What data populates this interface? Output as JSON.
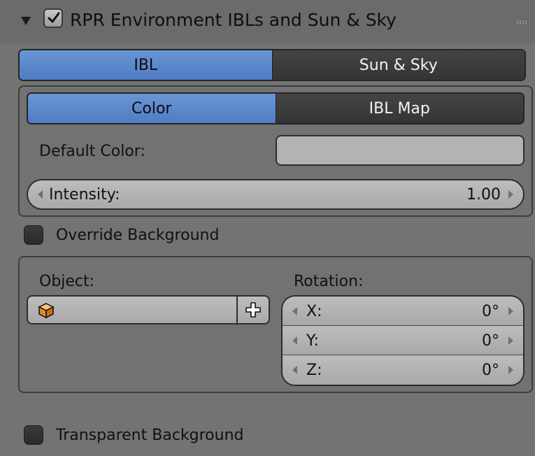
{
  "header": {
    "title": "RPR Environment IBLs and Sun & Sky",
    "enabled": true,
    "icons": {
      "collapse": "triangle-down-icon",
      "enable": "checkmark-icon",
      "drag": "grip-icon"
    }
  },
  "mode_tabs": {
    "options": [
      "IBL",
      "Sun & Sky"
    ],
    "selected": "IBL"
  },
  "ibl_tabs": {
    "options": [
      "Color",
      "IBL Map"
    ],
    "selected": "Color"
  },
  "default_color": {
    "label": "Default Color:",
    "value": "#b3b3b3"
  },
  "intensity": {
    "label": "Intensity:",
    "value": "1.00"
  },
  "override_background": {
    "label": "Override Background",
    "checked": false
  },
  "object": {
    "label": "Object:",
    "value": "",
    "icon": "object-cube-icon",
    "add_icon": "plus-icon"
  },
  "rotation": {
    "label": "Rotation:",
    "fields": [
      {
        "label": "X:",
        "value": "0°"
      },
      {
        "label": "Y:",
        "value": "0°"
      },
      {
        "label": "Z:",
        "value": "0°"
      }
    ]
  },
  "transparent_background": {
    "label": "Transparent Background",
    "checked": false
  },
  "colors": {
    "accent": "#5a87cc",
    "panel": "#737373",
    "inactive_tab": "#3c3c3c"
  }
}
